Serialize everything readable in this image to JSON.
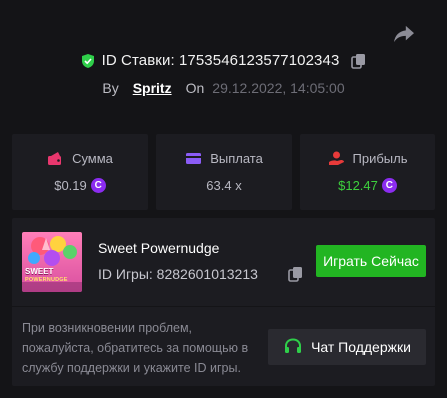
{
  "header": {
    "bet_id_label": "ID Ставки: 1753546123577102343",
    "by_label": "By",
    "username": "Spritz",
    "on_label": "On",
    "date": "29.12.2022, 14:05:00",
    "icons": {
      "verified": "shield-check-icon",
      "copy": "copy-icon",
      "share": "share-icon"
    }
  },
  "stats": {
    "sum": {
      "label": "Сумма",
      "value": "$0.19",
      "icon": "wallet-icon"
    },
    "payout": {
      "label": "Выплата",
      "value": "63.4 x",
      "icon": "card-icon"
    },
    "profit": {
      "label": "Прибыль",
      "value": "$12.47",
      "icon": "hand-coin-icon"
    },
    "coin_glyph": "C"
  },
  "game": {
    "thumb_title": "SWEET",
    "thumb_subtitle": "POWERNUDGE",
    "name": "Sweet Powernudge",
    "id_label": "ID Игры: 8282601013213",
    "play_label": "Играть Сейчас"
  },
  "support": {
    "help_text": "При возникновении проблем, пожалуйста, обратитесь за помощью в службу поддержки и укажите ID игры.",
    "button_label": "Чат Поддержки",
    "icon": "headset-icon"
  },
  "colors": {
    "background": "#141417",
    "panel": "#1c1c21",
    "accent_green": "#22b522",
    "profit_green": "#3dd13d",
    "coin_purple": "#8b2cf0",
    "sum_icon": "#e8376e",
    "payout_icon": "#8b5cf6",
    "profit_icon": "#e83a3a"
  }
}
